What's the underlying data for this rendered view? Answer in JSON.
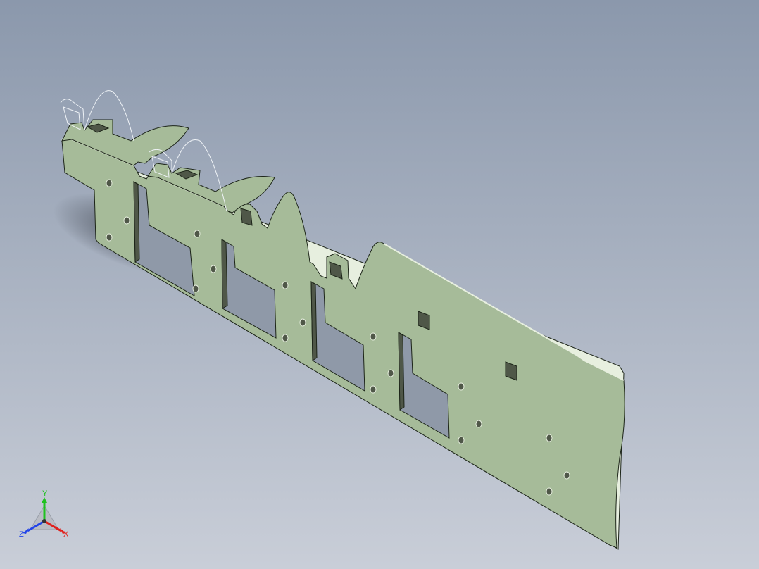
{
  "viewport": {
    "background_top_color": "#8b98ac",
    "background_bottom_color": "#c9ced8"
  },
  "model": {
    "part_fill_color": "#a6bb99",
    "part_edge_color": "#1c2418",
    "part_top_edge_color": "#e7efdf",
    "hole_shadow_color": "#4f5748",
    "cutout_color": "#8f99a8"
  },
  "triad": {
    "x_label": "X",
    "y_label": "Y",
    "z_label": "Z",
    "x_color": "#e0201c",
    "y_color": "#1fc21f",
    "z_color": "#2244e8"
  }
}
